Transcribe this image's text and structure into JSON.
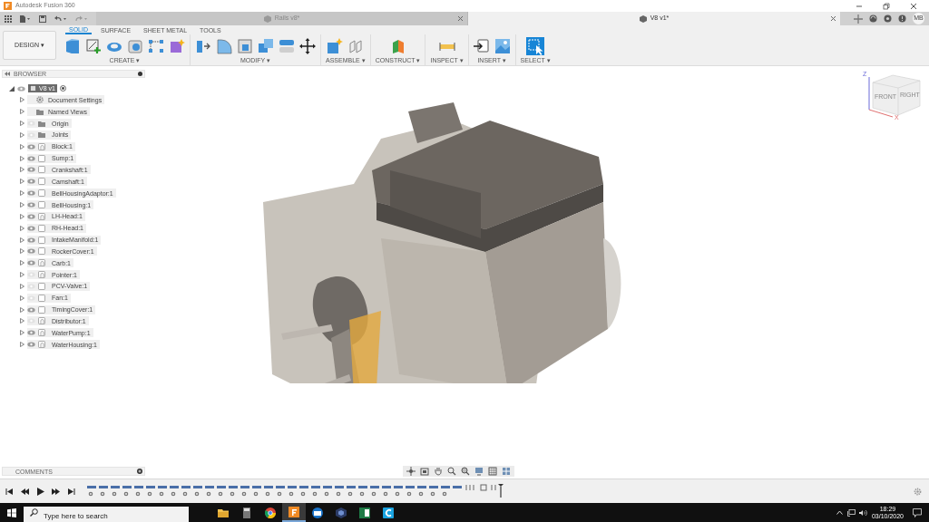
{
  "app_title": "Autodesk Fusion 360",
  "document_tabs": [
    {
      "label": "Rails v8*",
      "selected": false
    },
    {
      "label": "V8 v1*",
      "selected": true
    }
  ],
  "user_initials": "MB",
  "workspace": "DESIGN ▾",
  "toolbar_tabs": [
    {
      "label": "SOLID",
      "selected": true
    },
    {
      "label": "SURFACE",
      "selected": false
    },
    {
      "label": "SHEET METAL",
      "selected": false
    },
    {
      "label": "TOOLS",
      "selected": false
    }
  ],
  "tool_groups": [
    {
      "label": "CREATE ▾"
    },
    {
      "label": "MODIFY ▾"
    },
    {
      "label": "ASSEMBLE ▾"
    },
    {
      "label": "CONSTRUCT ▾"
    },
    {
      "label": "INSPECT ▾"
    },
    {
      "label": "INSERT ▾"
    },
    {
      "label": "SELECT ▾"
    }
  ],
  "browser": {
    "title": "BROWSER",
    "root": {
      "label": "V8 v1",
      "expanded": true,
      "children": [
        {
          "label": "Document Settings",
          "kind": "settings"
        },
        {
          "label": "Named Views",
          "kind": "views"
        },
        {
          "label": "Origin",
          "kind": "folder",
          "visible": false
        },
        {
          "label": "Joints",
          "kind": "folder",
          "visible": false
        },
        {
          "label": "Block:1",
          "kind": "linked",
          "visible": true
        },
        {
          "label": "Sump:1",
          "kind": "component",
          "visible": true
        },
        {
          "label": "Crankshaft:1",
          "kind": "component",
          "visible": true
        },
        {
          "label": "Camshaft:1",
          "kind": "component",
          "visible": true
        },
        {
          "label": "BellHousingAdaptor:1",
          "kind": "component",
          "visible": true
        },
        {
          "label": "BellHousing:1",
          "kind": "component",
          "visible": true
        },
        {
          "label": "LH-Head:1",
          "kind": "linked",
          "visible": true
        },
        {
          "label": "RH-Head:1",
          "kind": "component",
          "visible": true
        },
        {
          "label": "IntakeManifold:1",
          "kind": "component",
          "visible": true
        },
        {
          "label": "RockerCover:1",
          "kind": "component",
          "visible": true
        },
        {
          "label": "Carb:1",
          "kind": "linked",
          "visible": true
        },
        {
          "label": "Pointer:1",
          "kind": "linked",
          "visible": false
        },
        {
          "label": "PCV-Valve:1",
          "kind": "component",
          "visible": false
        },
        {
          "label": "Fan:1",
          "kind": "component",
          "visible": false
        },
        {
          "label": "TimingCover:1",
          "kind": "component",
          "visible": true
        },
        {
          "label": "Distributor:1",
          "kind": "linked",
          "visible": false
        },
        {
          "label": "WaterPump:1",
          "kind": "linked",
          "visible": true
        },
        {
          "label": "WaterHousing:1",
          "kind": "linked",
          "visible": true
        }
      ]
    }
  },
  "viewcube": {
    "faces": [
      "FRONT",
      "RIGHT"
    ],
    "axes": [
      "Z",
      "X"
    ]
  },
  "comments": {
    "title": "COMMENTS"
  },
  "taskbar": {
    "search_placeholder": "Type here to search",
    "time": "18:29",
    "date": "03/10/2020"
  }
}
